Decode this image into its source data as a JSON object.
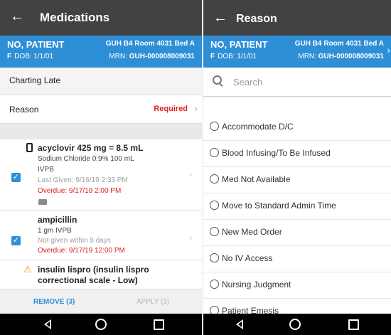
{
  "left": {
    "header": {
      "title": "Medications"
    },
    "patient": {
      "name": "NO, PATIENT",
      "sex": "F",
      "dob": "DOB: 1/1/01",
      "room": "GUH B4 Room 4031 Bed A",
      "mrn_label": "MRN:",
      "mrn": "GUH-000008009031"
    },
    "charting_late": "Charting Late",
    "reason": {
      "label": "Reason",
      "status": "Required"
    },
    "meds": [
      {
        "name": "acyclovir 425 mg = 8.5 mL",
        "line1": "Sodium Chloride 0.9% 100 mL",
        "line2": "IVPB",
        "line3": "Last Given: 9/16/19 2:33 PM",
        "line4": "Overdue: 9/17/19 2:00 PM"
      },
      {
        "name": "ampicillin",
        "line1": "1 gm IVPB",
        "line2": "Not given within 8 days",
        "line3": "Overdue: 9/17/19 12:00 PM"
      }
    ],
    "insulin": {
      "line1": "insulin lispro (insulin lispro",
      "line2": "correctional scale - Low)"
    },
    "actions": {
      "remove": "REMOVE (3)",
      "apply": "APPLY (3)"
    }
  },
  "right": {
    "header": {
      "title": "Reason"
    },
    "patient": {
      "name": "NO, PATIENT",
      "sex": "F",
      "dob": "DOB: 1/1/01",
      "room": "GUH B4 Room 4031 Bed A",
      "mrn_label": "MRN:",
      "mrn": "GUH-000008009031"
    },
    "search": {
      "placeholder": "Search"
    },
    "options": [
      "Accommodate D/C",
      "Blood Infusing/To Be Infused",
      "Med Not Available",
      "Move to Standard Admin Time",
      "New Med Order",
      "No IV Access",
      "Nursing Judgment",
      "Patient Emesis"
    ]
  },
  "colors": {
    "header_bg": "#424242",
    "patient_bar": "#2e8fd6",
    "required": "#e02020",
    "accent": "#2e8fd6"
  },
  "icons": [
    "back-arrow-icon",
    "chevron-right-icon",
    "checkbox-checked-icon",
    "phone-icon",
    "comment-icon",
    "warning-icon",
    "search-icon",
    "radio-icon",
    "nav-back-icon",
    "nav-home-icon",
    "nav-recent-icon"
  ]
}
